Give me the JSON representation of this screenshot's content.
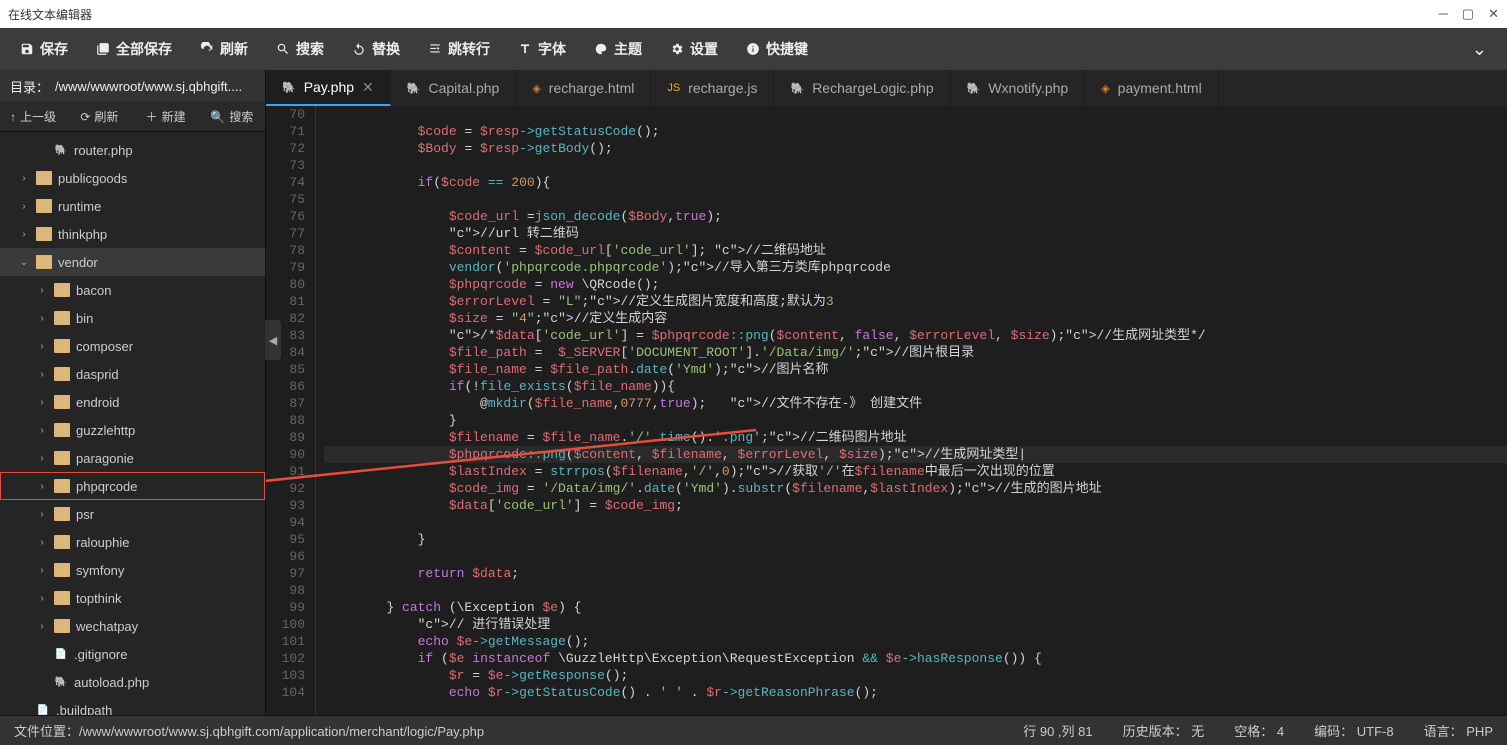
{
  "window": {
    "title": "在线文本编辑器"
  },
  "toolbar": {
    "save": "保存",
    "saveAll": "全部保存",
    "refresh": "刷新",
    "search": "搜索",
    "replace": "替换",
    "goto": "跳转行",
    "font": "字体",
    "theme": "主题",
    "settings": "设置",
    "shortcuts": "快捷键"
  },
  "sidebar": {
    "dirLabel": "目录：",
    "dirPath": "/www/wwwroot/www.sj.qbhgift....",
    "up": "上一级",
    "refresh": "刷新",
    "new": "新建",
    "search": "搜索",
    "tree": [
      {
        "name": "router.php",
        "type": "php",
        "depth": 2,
        "expandable": false
      },
      {
        "name": "publicgoods",
        "type": "folder",
        "depth": 1,
        "expandable": true
      },
      {
        "name": "runtime",
        "type": "folder",
        "depth": 1,
        "expandable": true
      },
      {
        "name": "thinkphp",
        "type": "folder",
        "depth": 1,
        "expandable": true
      },
      {
        "name": "vendor",
        "type": "folder",
        "depth": 1,
        "expandable": true,
        "expanded": true,
        "active": true
      },
      {
        "name": "bacon",
        "type": "folder",
        "depth": 2,
        "expandable": true
      },
      {
        "name": "bin",
        "type": "folder",
        "depth": 2,
        "expandable": true
      },
      {
        "name": "composer",
        "type": "folder",
        "depth": 2,
        "expandable": true
      },
      {
        "name": "dasprid",
        "type": "folder",
        "depth": 2,
        "expandable": true
      },
      {
        "name": "endroid",
        "type": "folder",
        "depth": 2,
        "expandable": true
      },
      {
        "name": "guzzlehttp",
        "type": "folder",
        "depth": 2,
        "expandable": true
      },
      {
        "name": "paragonie",
        "type": "folder",
        "depth": 2,
        "expandable": true
      },
      {
        "name": "phpqrcode",
        "type": "folder",
        "depth": 2,
        "expandable": true,
        "highlighted": true
      },
      {
        "name": "psr",
        "type": "folder",
        "depth": 2,
        "expandable": true
      },
      {
        "name": "ralouphie",
        "type": "folder",
        "depth": 2,
        "expandable": true
      },
      {
        "name": "symfony",
        "type": "folder",
        "depth": 2,
        "expandable": true
      },
      {
        "name": "topthink",
        "type": "folder",
        "depth": 2,
        "expandable": true
      },
      {
        "name": "wechatpay",
        "type": "folder",
        "depth": 2,
        "expandable": true
      },
      {
        "name": ".gitignore",
        "type": "file",
        "depth": 2,
        "expandable": false
      },
      {
        "name": "autoload.php",
        "type": "php",
        "depth": 2,
        "expandable": false
      },
      {
        "name": ".buildpath",
        "type": "file",
        "depth": 1,
        "expandable": false
      }
    ]
  },
  "tabs": [
    {
      "label": "Pay.php",
      "type": "php",
      "active": true,
      "dirty": true
    },
    {
      "label": "Capital.php",
      "type": "php"
    },
    {
      "label": "recharge.html",
      "type": "html"
    },
    {
      "label": "recharge.js",
      "type": "js"
    },
    {
      "label": "RechargeLogic.php",
      "type": "php"
    },
    {
      "label": "Wxnotify.php",
      "type": "php"
    },
    {
      "label": "payment.html",
      "type": "html"
    }
  ],
  "code": {
    "startLine": 70,
    "currentLine": 90,
    "lines": [
      "",
      "            $code = $resp->getStatusCode();",
      "            $Body = $resp->getBody();",
      "",
      "            if($code == 200){",
      "",
      "                $code_url =json_decode($Body,true);",
      "                //url 转二维码",
      "                $content = $code_url['code_url']; //二维码地址",
      "                vendor('phpqrcode.phpqrcode');//导入第三方类库phpqrcode",
      "                $phpqrcode = new \\QRcode();",
      "                $errorLevel = \"L\";//定义生成图片宽度和高度;默认为3",
      "                $size = \"4\";//定义生成内容",
      "                /*$data['code_url'] = $phpqrcode::png($content, false, $errorLevel, $size);//生成网址类型*/",
      "                $file_path =  $_SERVER['DOCUMENT_ROOT'].'/Data/img/';//图片根目录",
      "                $file_name = $file_path.date('Ymd');//图片名称",
      "                if(!file_exists($file_name)){",
      "                    @mkdir($file_name,0777,true);   //文件不存在-》 创建文件",
      "                }",
      "                $filename = $file_name.'/'.time().'.png';//二维码图片地址",
      "                $phpqrcode::png($content, $filename, $errorLevel, $size);//生成网址类型|",
      "                $lastIndex = strrpos($filename,'/',0);//获取'/'在$filename中最后一次出现的位置",
      "                $code_img = '/Data/img/'.date('Ymd').substr($filename,$lastIndex);//生成的图片地址",
      "                $data['code_url'] = $code_img;",
      "",
      "            }",
      "",
      "            return $data;",
      "",
      "        } catch (\\Exception $e) {",
      "            // 进行错误处理",
      "            echo $e->getMessage();",
      "            if ($e instanceof \\GuzzleHttp\\Exception\\RequestException && $e->hasResponse()) {",
      "                $r = $e->getResponse();",
      "                echo $r->getStatusCode() . ' ' . $r->getReasonPhrase();"
    ]
  },
  "statusbar": {
    "filePosLabel": "文件位置：",
    "filePath": "/www/wwwroot/www.sj.qbhgift.com/application/merchant/logic/Pay.php",
    "lineColLabel": "行 90 ,列 81",
    "historyLabel": "历史版本：",
    "historyVal": "无",
    "indentLabel": "空格：",
    "indentVal": "4",
    "encodingLabel": "编码：",
    "encodingVal": "UTF-8",
    "langLabel": "语言：",
    "langVal": "PHP"
  }
}
